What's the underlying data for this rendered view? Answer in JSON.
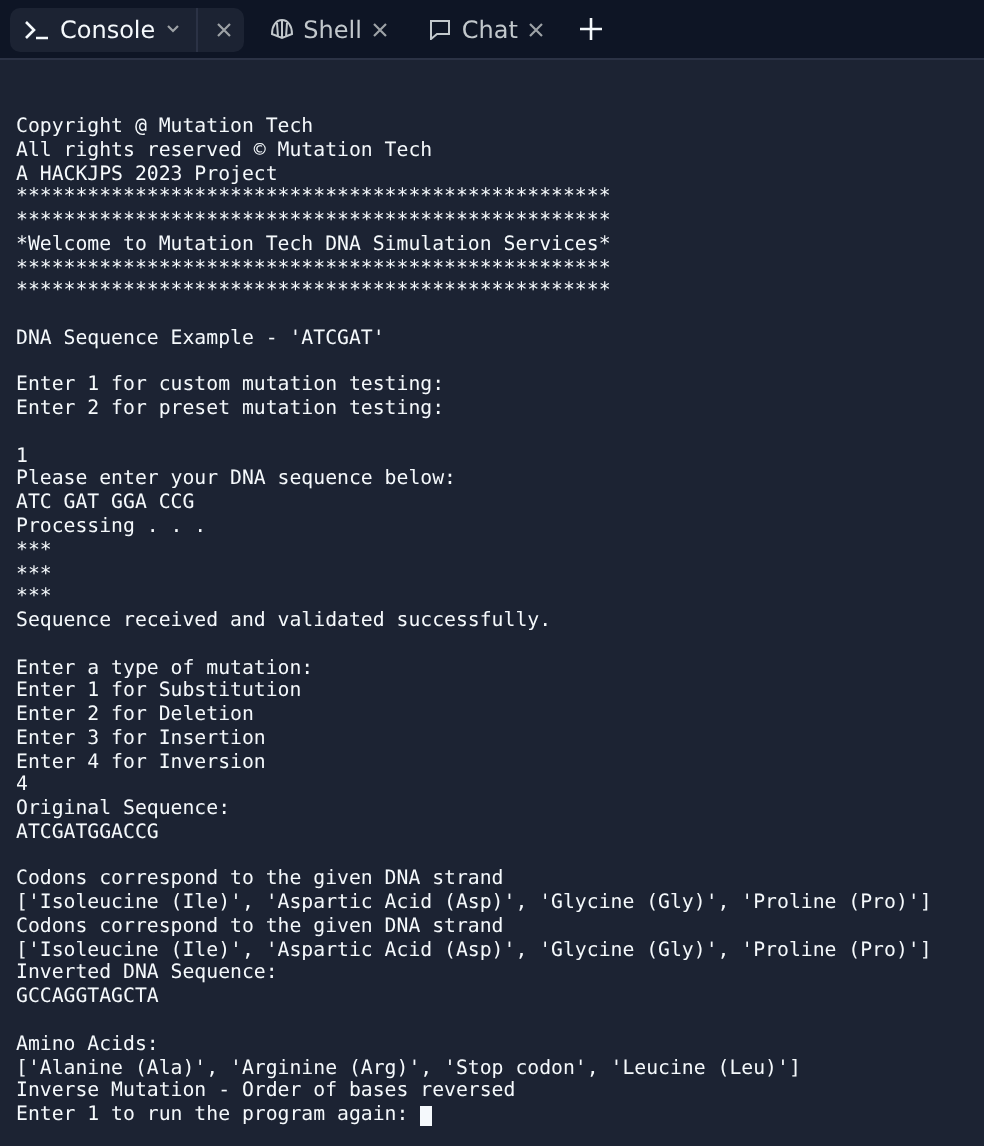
{
  "tabs": [
    {
      "label": "Console",
      "kind": "console",
      "selected": true
    },
    {
      "label": "Shell",
      "kind": "shell",
      "selected": false
    },
    {
      "label": "Chat",
      "kind": "chat",
      "selected": false
    }
  ],
  "console": {
    "cursor": true,
    "blocks": [
      [
        "Copyright @ Mutation Tech",
        "All rights reserved © Mutation Tech",
        "A HACKJPS 2023 Project",
        "**************************************************",
        "**************************************************",
        "*Welcome to Mutation Tech DNA Simulation Services*",
        "**************************************************",
        "**************************************************"
      ],
      [
        "DNA Sequence Example - 'ATCGAT'"
      ],
      [
        "Enter 1 for custom mutation testing:",
        "Enter 2 for preset mutation testing:"
      ],
      [
        "1",
        "Please enter your DNA sequence below:",
        "ATC GAT GGA CCG",
        "Processing . . .",
        "***",
        "***",
        "***",
        "Sequence received and validated successfully."
      ],
      [
        "Enter a type of mutation:",
        "Enter 1 for Substitution",
        "Enter 2 for Deletion",
        "Enter 3 for Insertion",
        "Enter 4 for Inversion",
        "4",
        "Original Sequence:",
        "ATCGATGGACCG"
      ],
      [
        "Codons correspond to the given DNA strand",
        "['Isoleucine (Ile)', 'Aspartic Acid (Asp)', 'Glycine (Gly)', 'Proline (Pro)']",
        "Codons correspond to the given DNA strand",
        "['Isoleucine (Ile)', 'Aspartic Acid (Asp)', 'Glycine (Gly)', 'Proline (Pro)']",
        "Inverted DNA Sequence:",
        "GCCAGGTAGCTA"
      ],
      [
        "Amino Acids:",
        "['Alanine (Ala)', 'Arginine (Arg)', 'Stop codon', 'Leucine (Leu)']",
        "Inverse Mutation - Order of bases reversed",
        "Enter 1 to run the program again: "
      ]
    ]
  }
}
